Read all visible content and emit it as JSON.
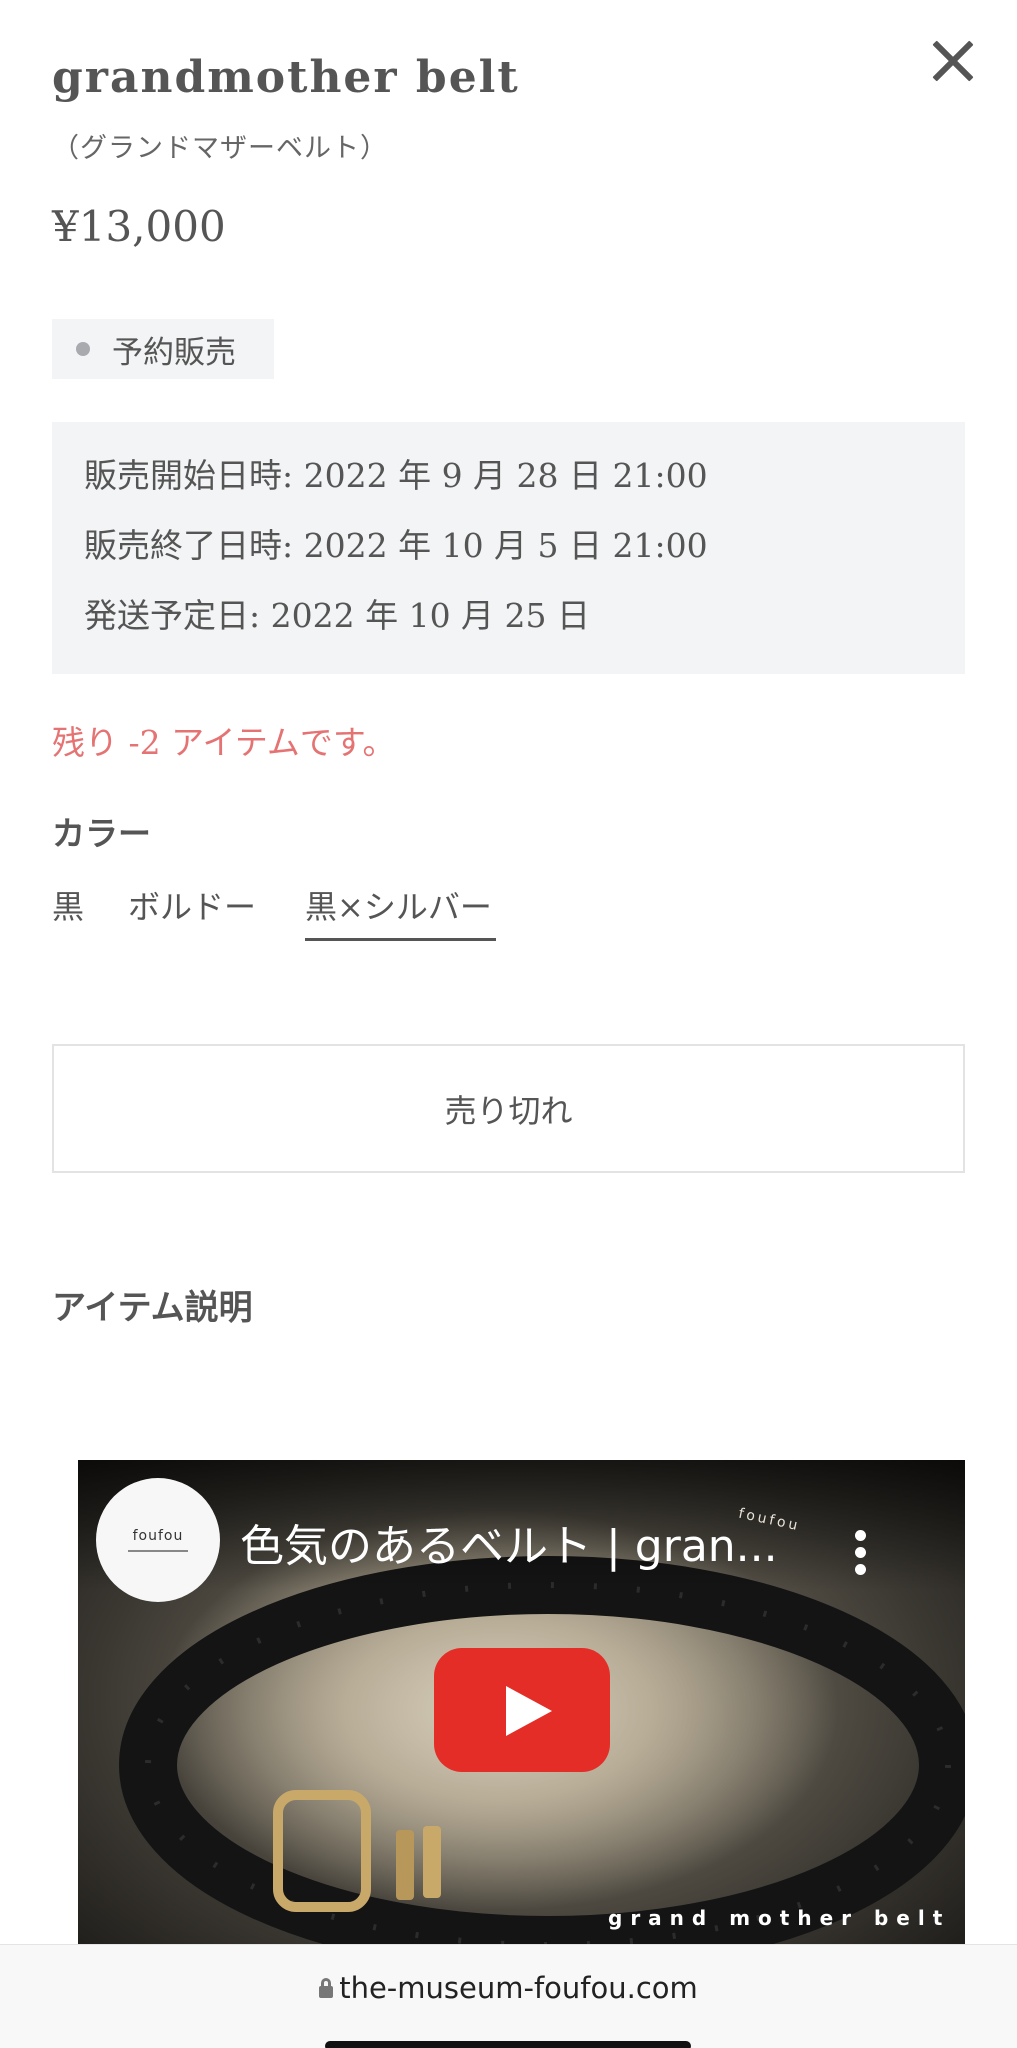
{
  "product": {
    "title": "grandmother belt",
    "subtitle": "（グランドマザーベルト）",
    "price": "¥13,000"
  },
  "badge": {
    "label": "予約販売"
  },
  "schedule": {
    "start": "販売開始日時: 2022 年 9 月 28 日 21:00",
    "end": "販売終了日時: 2022 年 10 月 5 日 21:00",
    "ship": "発送予定日: 2022 年 10 月 25 日"
  },
  "stock_note": "残り -2 アイテムです。",
  "color": {
    "heading": "カラー",
    "options": [
      "黒",
      "ボルドー",
      "黒×シルバー"
    ],
    "selected_index": 2
  },
  "soldout_label": "売り切れ",
  "description": {
    "heading": "アイテム説明"
  },
  "video": {
    "channel": "foufou",
    "title": "色気のあるベルト | gran...",
    "watermark": "grand mother belt",
    "watermark_top": "foufou"
  },
  "browser": {
    "url": "the-museum-foufou.com"
  },
  "colors": {
    "stock_red": "#e57373",
    "play_red": "#e52d27",
    "badge_bg": "#f3f4f5"
  }
}
